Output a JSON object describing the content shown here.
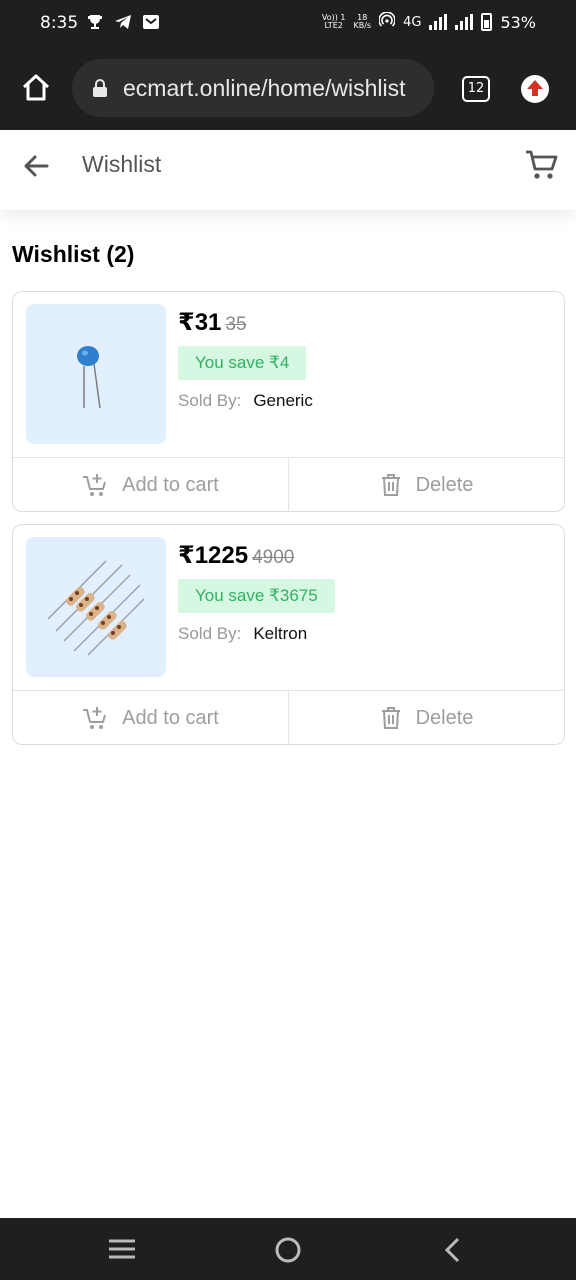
{
  "status_bar": {
    "time": "8:35",
    "network_top": "Vo)) 1",
    "network_bottom": "LTE2",
    "speed_value": "18",
    "speed_unit": "KB/s",
    "network_type": "4G",
    "battery": "53%",
    "battery_level": 0.53
  },
  "browser": {
    "url": "ecmart.online/home/wishlist",
    "tab_count": "12"
  },
  "header": {
    "title": "Wishlist"
  },
  "page": {
    "heading": "Wishlist (2)"
  },
  "items": [
    {
      "price": "₹31",
      "mrp": "35",
      "savings": "You save ₹4",
      "seller_label": "Sold By:",
      "seller": "Generic",
      "add_to_cart": "Add to cart",
      "delete": "Delete"
    },
    {
      "price": "₹1225",
      "mrp": "4900",
      "savings": "You save ₹3675",
      "seller_label": "Sold By:",
      "seller": "Keltron",
      "add_to_cart": "Add to cart",
      "delete": "Delete"
    }
  ],
  "colors": {
    "savings_bg": "#d6f7e2",
    "savings_text": "#2fb361",
    "thumb_bg": "#e1efff",
    "system_bar": "#1f1f1f"
  }
}
